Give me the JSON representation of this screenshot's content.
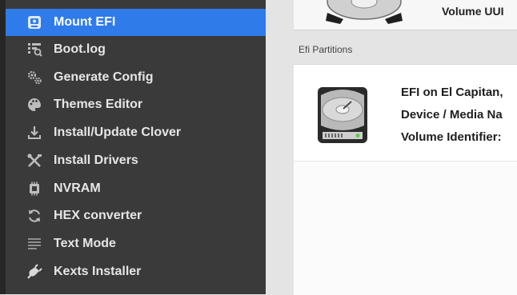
{
  "sidebar": {
    "items": [
      {
        "label": "Mount EFI",
        "icon": "mount-efi-icon",
        "active": true
      },
      {
        "label": "Boot.log",
        "icon": "boot-log-icon"
      },
      {
        "label": "Generate Config",
        "icon": "gears-icon"
      },
      {
        "label": "Themes Editor",
        "icon": "palette-icon"
      },
      {
        "label": "Install/Update Clover",
        "icon": "download-icon"
      },
      {
        "label": "Install Drivers",
        "icon": "tools-icon"
      },
      {
        "label": "NVRAM",
        "icon": "chip-icon"
      },
      {
        "label": "HEX converter",
        "icon": "refresh-icon"
      },
      {
        "label": "Text Mode",
        "icon": "text-lines-icon"
      },
      {
        "label": "Kexts Installer",
        "icon": "plug-icon"
      }
    ]
  },
  "main": {
    "top_volume_label": "Volume UUI",
    "section_title": "Efi Partitions",
    "efi_entry": {
      "name": "EFI on El Capitan,",
      "device_media": "Device / Media Na",
      "volume_identifier": "Volume Identifier:"
    }
  },
  "colors": {
    "sidebar_bg": "#3a3a3a",
    "active_accent": "#2f7bea",
    "main_bg": "#e4e4e4"
  }
}
